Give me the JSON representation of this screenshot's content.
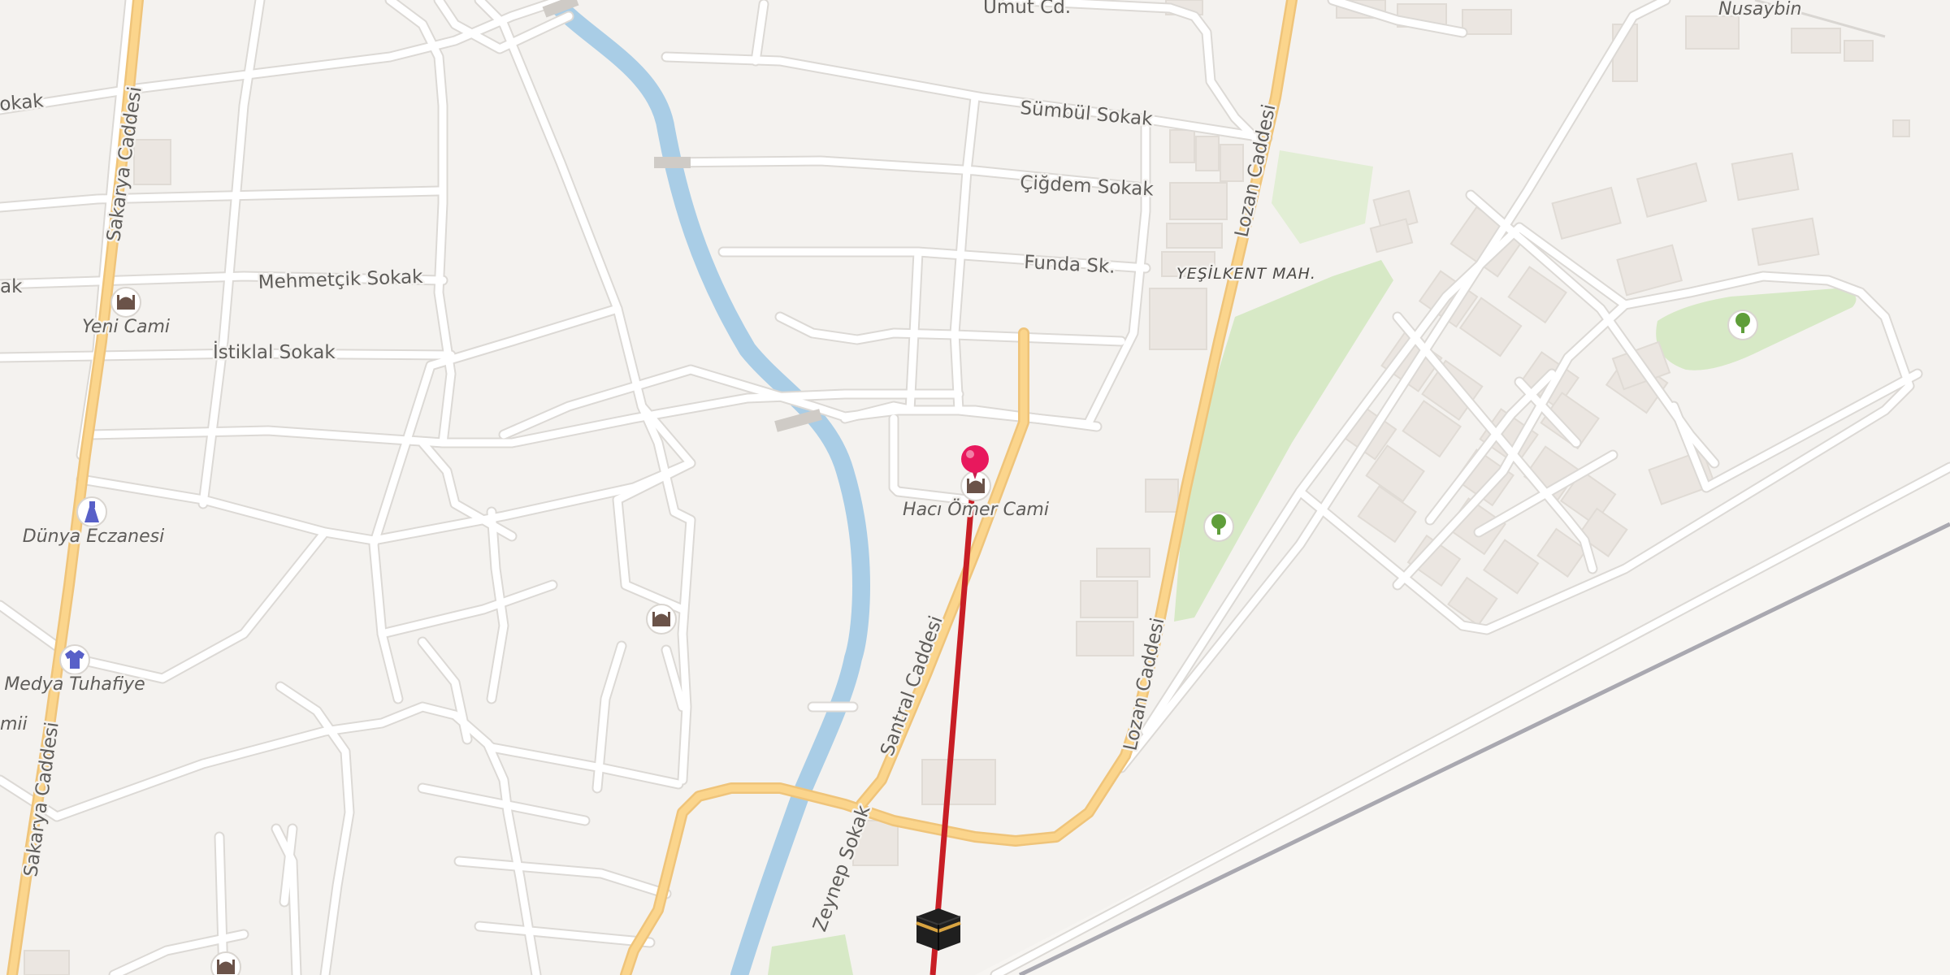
{
  "map": {
    "colors": {
      "background": "#f4f2ef",
      "minor_road": "#ffffff",
      "road_casing": "#dcd9d5",
      "main_road": "#fbd58c",
      "main_road_casing": "#efc47a",
      "river": "#a9cde6",
      "park": "#d7e9c6",
      "building": "#ebe6e1",
      "railway": "#a9a8b0",
      "qibla_line": "#d6232a",
      "pin": "#e8185d"
    },
    "streets": {
      "umut": "Umut Cd.",
      "nusaybin": "Nusaybin",
      "sokak_left": "okak",
      "sumbul": "Sümbül Sokak",
      "cigdem": "Çiğdem Sokak",
      "funda": "Funda Sk.",
      "ak_left": "ak",
      "mehmetcik": "Mehmetçik Sokak",
      "istiklal": "İstiklal Sokak",
      "sakarya_top": "Sakarya Caddesi",
      "sakarya_bottom": "Sakarya Caddesi",
      "lozan_top": "Lozan Caddesi",
      "lozan_bottom": "Lozan Caddesi",
      "santral": "Santral Caddesi",
      "zeynep": "Zeynep Sokak",
      "mii_left": "mii"
    },
    "areas": {
      "yesilkent": "YEŞİLKENT MAH."
    },
    "pois": {
      "yeni_cami": {
        "label": "Yeni Cami",
        "icon": "mosque-icon"
      },
      "haci_omer_cami": {
        "label": "Hacı Ömer Cami",
        "icon": "mosque-icon"
      },
      "dunya_eczanesi": {
        "label": "Dünya Eczanesi",
        "icon": "pharmacy-icon"
      },
      "medya_tuhafiye": {
        "label": "Medya Tuhafiye",
        "icon": "clothing-icon"
      },
      "mosque_center": {
        "icon": "mosque-icon"
      },
      "mosque_bottom": {
        "icon": "mosque-icon"
      },
      "park_center": {
        "icon": "tree-icon"
      },
      "park_east": {
        "icon": "tree-icon"
      }
    },
    "markers": {
      "location_pin": {
        "icon": "location-pin-icon"
      },
      "kaaba": {
        "icon": "kaaba-icon"
      }
    }
  }
}
